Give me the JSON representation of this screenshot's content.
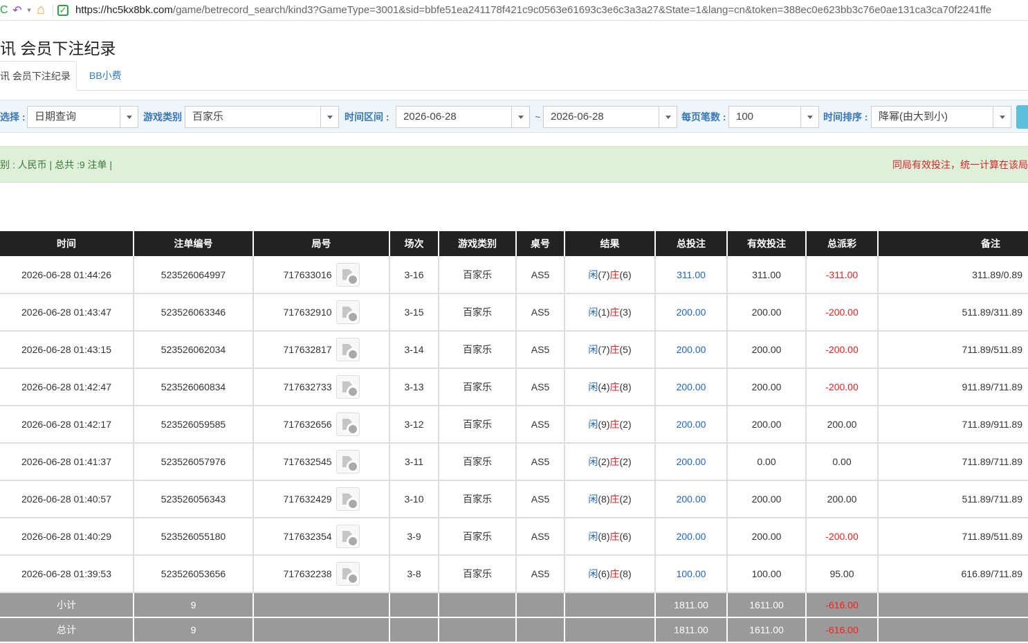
{
  "browser": {
    "url_host": "https://hc5kx8bk.com",
    "url_path": "/game/betrecord_search/kind3?GameType=3001&sid=bbfe51ea241178f421c9c0563e61693c3e6c3a3a27&State=1&lang=cn&token=388ec0e623bb3c76e0ae131ca3ca70f2241ffe",
    "reload_glyph": "C",
    "undo_glyph": "↶",
    "dropdown_glyph": "▾",
    "home_glyph": "⌂",
    "shield_glyph": "✓"
  },
  "page": {
    "title": "讯 会员下注纪录",
    "tabs": [
      {
        "label": "讯 会员下注纪录",
        "active": true
      },
      {
        "label": "BB小费",
        "active": false
      }
    ]
  },
  "filters": {
    "select_label": "选择 :",
    "select_value": "日期查询",
    "game_type_label": "游戏类别",
    "game_type_value": "百家乐",
    "range_label": "时间区间 :",
    "date_from": "2026-06-28",
    "range_sep": "~",
    "date_to": "2026-06-28",
    "per_page_label": "每页笔数 :",
    "per_page_value": "100",
    "sort_label": "时间排序 :",
    "sort_value": "降幂(由大到小)"
  },
  "summary": {
    "left": "别 : 人民币 | 总共 :9 注单 |",
    "right": "同局有效投注，统一计算在该局"
  },
  "table": {
    "headers": [
      "时间",
      "注单编号",
      "局号",
      "场次",
      "游戏类别",
      "桌号",
      "结果",
      "总投注",
      "有效投注",
      "总派彩",
      "备注"
    ],
    "rows": [
      {
        "time": "2026-06-28 01:44:26",
        "order": "523526064997",
        "round": "717633016",
        "game_no": "3-16",
        "game": "百家乐",
        "table": "AS5",
        "p_label": "闲",
        "p": "(7)",
        "b_label": "庄",
        "b": "(6)",
        "bet": "311.00",
        "valid": "311.00",
        "payout": "-311.00",
        "payout_neg": true,
        "note": "311.89/0.89"
      },
      {
        "time": "2026-06-28 01:43:47",
        "order": "523526063346",
        "round": "717632910",
        "game_no": "3-15",
        "game": "百家乐",
        "table": "AS5",
        "p_label": "闲",
        "p": "(1)",
        "b_label": "庄",
        "b": "(3)",
        "bet": "200.00",
        "valid": "200.00",
        "payout": "-200.00",
        "payout_neg": true,
        "note": "511.89/311.89"
      },
      {
        "time": "2026-06-28 01:43:15",
        "order": "523526062034",
        "round": "717632817",
        "game_no": "3-14",
        "game": "百家乐",
        "table": "AS5",
        "p_label": "闲",
        "p": "(7)",
        "b_label": "庄",
        "b": "(5)",
        "bet": "200.00",
        "valid": "200.00",
        "payout": "-200.00",
        "payout_neg": true,
        "note": "711.89/511.89"
      },
      {
        "time": "2026-06-28 01:42:47",
        "order": "523526060834",
        "round": "717632733",
        "game_no": "3-13",
        "game": "百家乐",
        "table": "AS5",
        "p_label": "闲",
        "p": "(4)",
        "b_label": "庄",
        "b": "(8)",
        "bet": "200.00",
        "valid": "200.00",
        "payout": "-200.00",
        "payout_neg": true,
        "note": "911.89/711.89"
      },
      {
        "time": "2026-06-28 01:42:17",
        "order": "523526059585",
        "round": "717632656",
        "game_no": "3-12",
        "game": "百家乐",
        "table": "AS5",
        "p_label": "闲",
        "p": "(9)",
        "b_label": "庄",
        "b": "(2)",
        "bet": "200.00",
        "valid": "200.00",
        "payout": "200.00",
        "payout_neg": false,
        "note": "711.89/911.89"
      },
      {
        "time": "2026-06-28 01:41:37",
        "order": "523526057976",
        "round": "717632545",
        "game_no": "3-11",
        "game": "百家乐",
        "table": "AS5",
        "p_label": "闲",
        "p": "(2)",
        "b_label": "庄",
        "b": "(2)",
        "bet": "200.00",
        "valid": "0.00",
        "payout": "0.00",
        "payout_neg": false,
        "note": "711.89/711.89"
      },
      {
        "time": "2026-06-28 01:40:57",
        "order": "523526056343",
        "round": "717632429",
        "game_no": "3-10",
        "game": "百家乐",
        "table": "AS5",
        "p_label": "闲",
        "p": "(8)",
        "b_label": "庄",
        "b": "(2)",
        "bet": "200.00",
        "valid": "200.00",
        "payout": "200.00",
        "payout_neg": false,
        "note": "511.89/711.89"
      },
      {
        "time": "2026-06-28 01:40:29",
        "order": "523526055180",
        "round": "717632354",
        "game_no": "3-9",
        "game": "百家乐",
        "table": "AS5",
        "p_label": "闲",
        "p": "(8)",
        "b_label": "庄",
        "b": "(6)",
        "bet": "200.00",
        "valid": "200.00",
        "payout": "-200.00",
        "payout_neg": true,
        "note": "711.89/511.89"
      },
      {
        "time": "2026-06-28 01:39:53",
        "order": "523526053656",
        "round": "717632238",
        "game_no": "3-8",
        "game": "百家乐",
        "table": "AS5",
        "p_label": "闲",
        "p": "(6)",
        "b_label": "庄",
        "b": "(8)",
        "bet": "100.00",
        "valid": "100.00",
        "payout": "95.00",
        "payout_neg": false,
        "note": "616.89/711.89"
      }
    ],
    "totals": [
      {
        "label": "小计",
        "count": "9",
        "bet": "1811.00",
        "valid": "1611.00",
        "payout": "-616.00"
      },
      {
        "label": "总计",
        "count": "9",
        "bet": "1811.00",
        "valid": "1611.00",
        "payout": "-616.00"
      }
    ]
  },
  "colors": {
    "header_bg": "#222222",
    "link_blue": "#1f64c8",
    "loss_red": "#e32222",
    "summary_bg": "#dff0d8",
    "filter_bg": "#eef5fb",
    "total_bg": "#9a9a9a"
  }
}
